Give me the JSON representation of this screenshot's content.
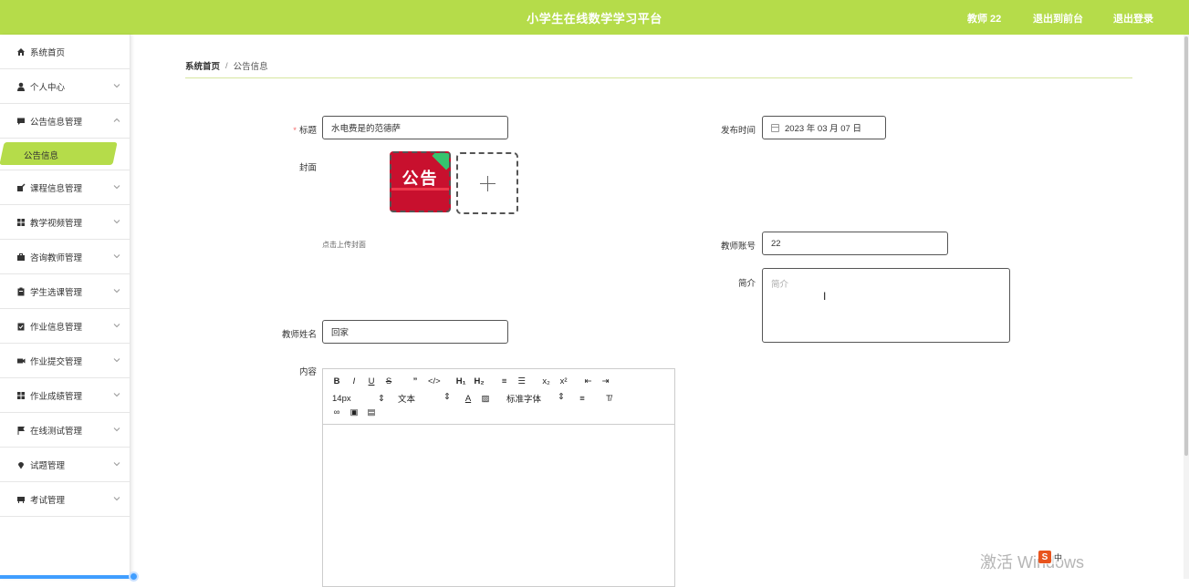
{
  "header": {
    "title": "小学生在线数学学习平台",
    "user_label": "教师 22",
    "back_label": "退出到前台",
    "logout_label": "退出登录"
  },
  "sidebar": {
    "items": [
      {
        "label": "系统首页",
        "icon": "home-icon",
        "expandable": false
      },
      {
        "label": "个人中心",
        "icon": "user-icon",
        "expandable": true
      },
      {
        "label": "公告信息管理",
        "icon": "chat-icon",
        "expandable": true,
        "expanded": true
      },
      {
        "label": "课程信息管理",
        "icon": "edit-icon",
        "expandable": true
      },
      {
        "label": "教学视频管理",
        "icon": "grid-icon",
        "expandable": true
      },
      {
        "label": "咨询教师管理",
        "icon": "briefcase-icon",
        "expandable": true
      },
      {
        "label": "学生选课管理",
        "icon": "clipboard-icon",
        "expandable": true
      },
      {
        "label": "作业信息管理",
        "icon": "clipboard-check-icon",
        "expandable": true
      },
      {
        "label": "作业提交管理",
        "icon": "video-icon",
        "expandable": true
      },
      {
        "label": "作业成绩管理",
        "icon": "grid-icon",
        "expandable": true
      },
      {
        "label": "在线测试管理",
        "icon": "flag-icon",
        "expandable": true
      },
      {
        "label": "试题管理",
        "icon": "pin-icon",
        "expandable": true
      },
      {
        "label": "考试管理",
        "icon": "desk-icon",
        "expandable": true
      }
    ],
    "active_sub": "公告信息"
  },
  "breadcrumb": {
    "home": "系统首页",
    "separator": "/",
    "current": "公告信息"
  },
  "form": {
    "title_label": "标题",
    "title_value": "水电费是的范德萨",
    "publish_time_label": "发布时间",
    "publish_time_value": "2023 年 03 月 07 日",
    "cover_label": "封面",
    "cover_image_text": "公告",
    "cover_hint": "点击上传封面",
    "teacher_account_label": "教师账号",
    "teacher_account_value": "22",
    "intro_label": "简介",
    "intro_placeholder": "简介",
    "teacher_name_label": "教师姓名",
    "teacher_name_value": "回家",
    "content_label": "内容"
  },
  "editor": {
    "font_size": "14px",
    "text_type": "文本",
    "font_family": "标准字体"
  },
  "overlay": {
    "watermark": "激活 Windows",
    "ime": "中"
  },
  "colors": {
    "brand": "#b5dc4a",
    "required": "#f56c6c",
    "progress": "#409eff"
  }
}
